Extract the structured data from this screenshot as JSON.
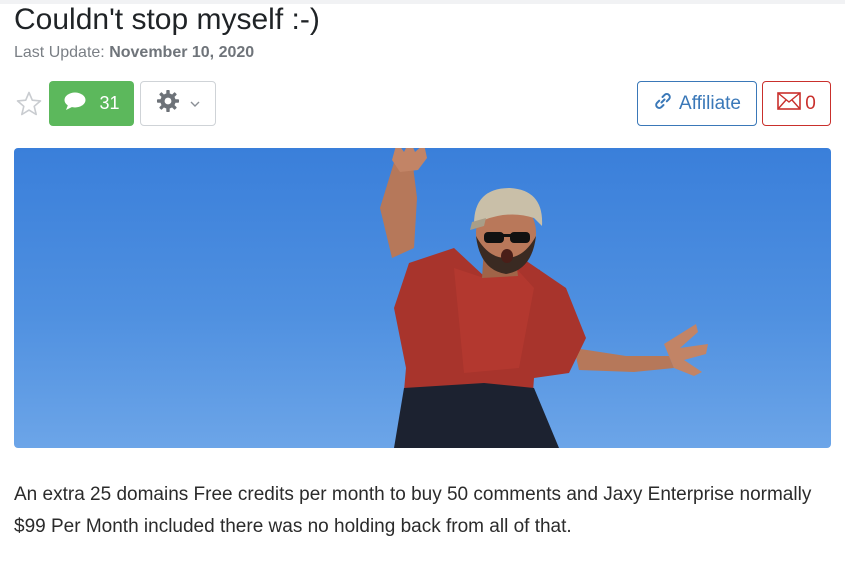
{
  "post": {
    "title": "Couldn't stop myself :-)",
    "last_update_label": "Last Update:",
    "last_update_date": "November 10, 2020",
    "body": "An extra 25 domains Free credits per month to buy 50 comments and Jaxy Enterprise normally $99 Per Month included there was no holding back from all of that."
  },
  "actions": {
    "favorite_icon": "star-outline-icon",
    "comment_icon": "speech-bubble-icon",
    "comment_count": "31",
    "settings_icon": "gear-icon",
    "settings_caret_icon": "chevron-down-icon",
    "affiliate_icon": "link-icon",
    "affiliate_label": "Affiliate",
    "message_icon": "envelope-icon",
    "message_count": "0"
  },
  "colors": {
    "comment_button": "#5cb85c",
    "affiliate_border": "#3a78b8",
    "message_border": "#c9302c",
    "sky": "#4a8ade"
  }
}
